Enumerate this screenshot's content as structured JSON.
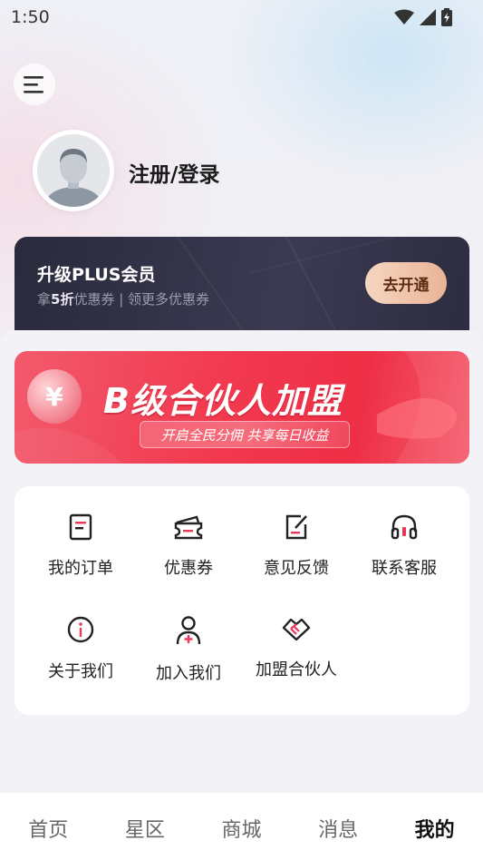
{
  "status_bar": {
    "time": "1:50"
  },
  "header": {
    "menu_icon": "hamburger-icon"
  },
  "profile": {
    "login_label": "注册/登录",
    "avatar_icon": "default-avatar-icon"
  },
  "plus": {
    "title": "升级PLUS会员",
    "sub_prefix": "拿",
    "sub_highlight": "5折",
    "sub_suffix": "优惠券 | 领更多优惠券",
    "button": "去开通"
  },
  "banner": {
    "title": "B级合伙人加盟",
    "subtitle": "开启全民分佣  共享每日收益"
  },
  "menu": {
    "items": [
      {
        "label": "我的订单",
        "icon": "order-icon"
      },
      {
        "label": "优惠券",
        "icon": "coupon-icon"
      },
      {
        "label": "意见反馈",
        "icon": "feedback-icon"
      },
      {
        "label": "联系客服",
        "icon": "headset-icon"
      },
      {
        "label": "关于我们",
        "icon": "info-icon"
      },
      {
        "label": "加入我们",
        "icon": "add-user-icon"
      },
      {
        "label": "加盟合伙人",
        "icon": "handshake-icon"
      }
    ]
  },
  "tabs": [
    {
      "label": "首页"
    },
    {
      "label": "星区"
    },
    {
      "label": "商城"
    },
    {
      "label": "消息"
    },
    {
      "label": "我的",
      "active": true
    }
  ],
  "colors": {
    "accent": "#e8395a",
    "plus_bg": "#2f2e44",
    "plus_btn": "#f0c4a8"
  }
}
